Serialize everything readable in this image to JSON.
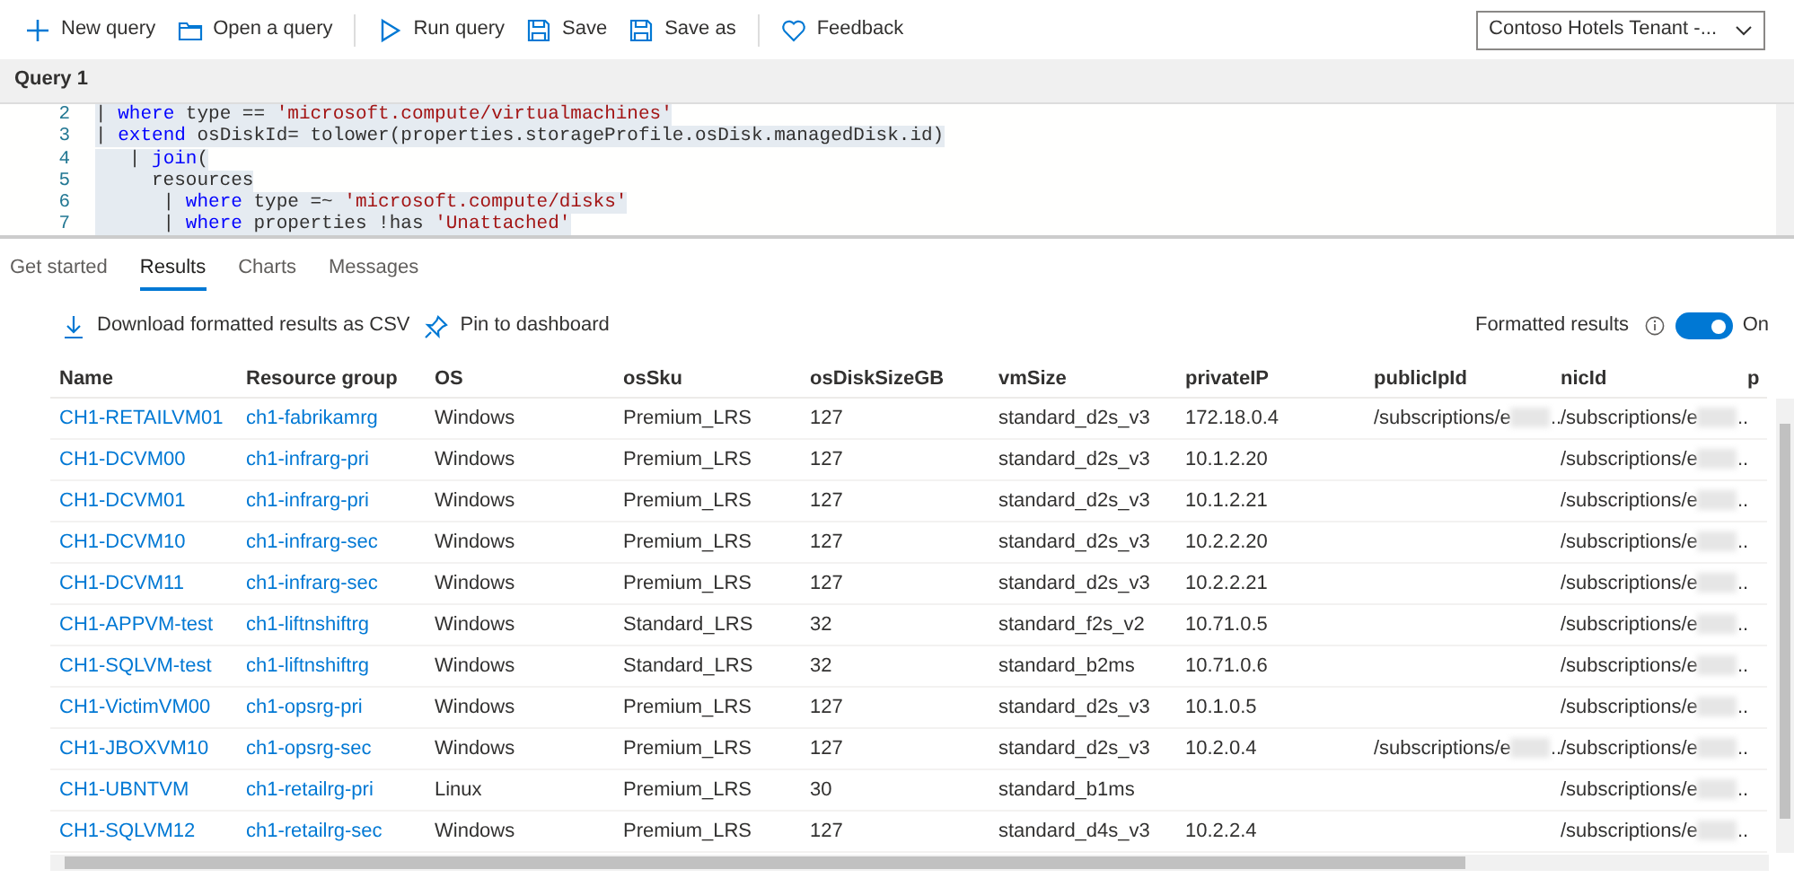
{
  "toolbar": [
    {
      "label": "New query",
      "kind": "plus"
    },
    {
      "label": "Open a query",
      "kind": "folder"
    },
    {
      "label": "Run query",
      "kind": "play",
      "divider_before": true
    },
    {
      "label": "Save",
      "kind": "disk"
    },
    {
      "label": "Save as",
      "kind": "disk"
    },
    {
      "label": "Feedback",
      "kind": "heart",
      "divider_before": true
    }
  ],
  "tenant_select": {
    "value": "Contoso Hotels Tenant -..."
  },
  "query_tabs": [
    {
      "label": "Query 1",
      "selected": true
    }
  ],
  "editor": {
    "lines": [
      {
        "number": "2",
        "tokens": [
          {
            "text": "| ",
            "kind": "plain"
          },
          {
            "text": "where",
            "kind": "keyword"
          },
          {
            "text": " type == ",
            "kind": "plain"
          },
          {
            "text": "'microsoft.compute/virtualmachines'",
            "kind": "string"
          }
        ]
      },
      {
        "number": "3",
        "tokens": [
          {
            "text": "| ",
            "kind": "plain"
          },
          {
            "text": "extend",
            "kind": "keyword"
          },
          {
            "text": " osDiskId= tolower(properties.storageProfile.osDisk.managedDisk.id)",
            "kind": "plain"
          }
        ]
      },
      {
        "number": "4",
        "tokens": [
          {
            "text": "   | ",
            "kind": "plain"
          },
          {
            "text": "join",
            "kind": "keyword"
          },
          {
            "text": "(",
            "kind": "plain"
          }
        ]
      },
      {
        "number": "5",
        "tokens": [
          {
            "text": "     resources",
            "kind": "plain"
          }
        ]
      },
      {
        "number": "6",
        "tokens": [
          {
            "text": "      | ",
            "kind": "plain"
          },
          {
            "text": "where",
            "kind": "keyword"
          },
          {
            "text": " type =~ ",
            "kind": "plain"
          },
          {
            "text": "'microsoft.compute/disks'",
            "kind": "string"
          }
        ]
      },
      {
        "number": "7",
        "tokens": [
          {
            "text": "      | ",
            "kind": "plain"
          },
          {
            "text": "where",
            "kind": "keyword"
          },
          {
            "text": " properties !has ",
            "kind": "plain"
          },
          {
            "text": "'Unattached'",
            "kind": "string"
          }
        ]
      }
    ]
  },
  "result_tabs": [
    {
      "label": "Get started",
      "selected": false
    },
    {
      "label": "Results",
      "selected": true
    },
    {
      "label": "Charts",
      "selected": false
    },
    {
      "label": "Messages",
      "selected": false
    }
  ],
  "actions": [
    {
      "label": "Download formatted results as CSV",
      "kind": "download"
    },
    {
      "label": "Pin to dashboard",
      "kind": "pin"
    }
  ],
  "formatted_results": {
    "label": "Formatted results",
    "on": true,
    "state_label": "On"
  },
  "table": {
    "columns": [
      {
        "label": "Name",
        "kind": "link"
      },
      {
        "label": "Resource group",
        "kind": "link"
      },
      {
        "label": "OS",
        "kind": "text"
      },
      {
        "label": "osSku",
        "kind": "text"
      },
      {
        "label": "osDiskSizeGB",
        "kind": "text"
      },
      {
        "label": "vmSize",
        "kind": "text"
      },
      {
        "label": "privateIP",
        "kind": "text"
      },
      {
        "label": "publicIpId",
        "kind": "redacted"
      },
      {
        "label": "nicId",
        "kind": "redacted"
      },
      {
        "label": "p"
      }
    ],
    "rows": [
      [
        "CH1-RETAILVM01",
        "ch1-fabrikamrg",
        "Windows",
        "Premium_LRS",
        "127",
        "standard_d2s_v3",
        "172.18.0.4",
        {
          "prefix": "/subscriptions/e",
          "suffix": ".."
        },
        {
          "prefix": "/subscriptions/e",
          "suffix": ".."
        }
      ],
      [
        "CH1-DCVM00",
        "ch1-infrarg-pri",
        "Windows",
        "Premium_LRS",
        "127",
        "standard_d2s_v3",
        "10.1.2.20",
        null,
        {
          "prefix": "/subscriptions/e",
          "suffix": ".."
        }
      ],
      [
        "CH1-DCVM01",
        "ch1-infrarg-pri",
        "Windows",
        "Premium_LRS",
        "127",
        "standard_d2s_v3",
        "10.1.2.21",
        null,
        {
          "prefix": "/subscriptions/e",
          "suffix": ".."
        }
      ],
      [
        "CH1-DCVM10",
        "ch1-infrarg-sec",
        "Windows",
        "Premium_LRS",
        "127",
        "standard_d2s_v3",
        "10.2.2.20",
        null,
        {
          "prefix": "/subscriptions/e",
          "suffix": ".."
        }
      ],
      [
        "CH1-DCVM11",
        "ch1-infrarg-sec",
        "Windows",
        "Premium_LRS",
        "127",
        "standard_d2s_v3",
        "10.2.2.21",
        null,
        {
          "prefix": "/subscriptions/e",
          "suffix": ".."
        }
      ],
      [
        "CH1-APPVM-test",
        "ch1-liftnshiftrg",
        "Windows",
        "Standard_LRS",
        "32",
        "standard_f2s_v2",
        "10.71.0.5",
        null,
        {
          "prefix": "/subscriptions/e",
          "suffix": ".."
        }
      ],
      [
        "CH1-SQLVM-test",
        "ch1-liftnshiftrg",
        "Windows",
        "Standard_LRS",
        "32",
        "standard_b2ms",
        "10.71.0.6",
        null,
        {
          "prefix": "/subscriptions/e",
          "suffix": ".."
        }
      ],
      [
        "CH1-VictimVM00",
        "ch1-opsrg-pri",
        "Windows",
        "Premium_LRS",
        "127",
        "standard_d2s_v3",
        "10.1.0.5",
        null,
        {
          "prefix": "/subscriptions/e",
          "suffix": ".."
        }
      ],
      [
        "CH1-JBOXVM10",
        "ch1-opsrg-sec",
        "Windows",
        "Premium_LRS",
        "127",
        "standard_d2s_v3",
        "10.2.0.4",
        {
          "prefix": "/subscriptions/e",
          "suffix": ".."
        },
        {
          "prefix": "/subscriptions/e",
          "suffix": ".."
        }
      ],
      [
        "CH1-UBNTVM",
        "ch1-retailrg-pri",
        "Linux",
        "Premium_LRS",
        "30",
        "standard_b1ms",
        null,
        null,
        {
          "prefix": "/subscriptions/e",
          "suffix": ".."
        }
      ],
      [
        "CH1-SQLVM12",
        "ch1-retailrg-sec",
        "Windows",
        "Premium_LRS",
        "127",
        "standard_d4s_v3",
        "10.2.2.4",
        null,
        {
          "prefix": "/subscriptions/e",
          "suffix": ".."
        }
      ]
    ]
  }
}
